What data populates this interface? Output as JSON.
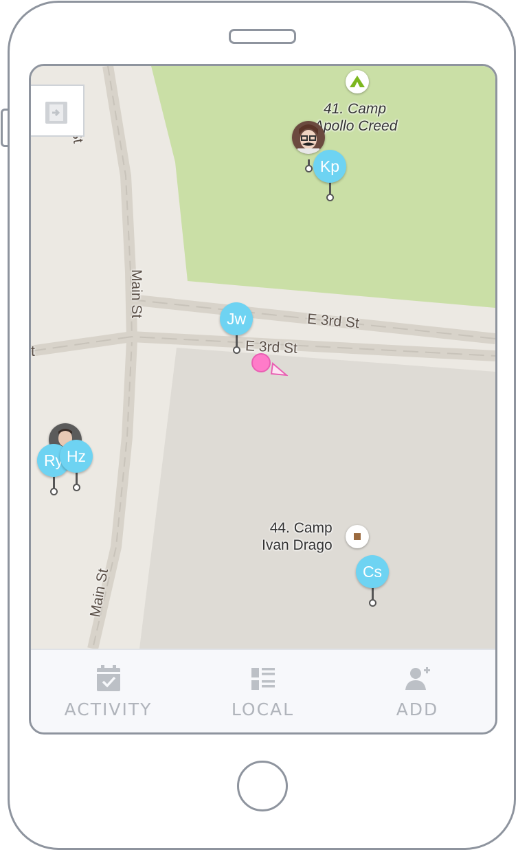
{
  "map": {
    "streets": {
      "main_st_top": "Main St",
      "main_st_mid": "Main St",
      "main_st_bottom": "Main St",
      "e3rd_upper": "E 3rd St",
      "e3rd_lower": "E 3rd St",
      "cut_off_left": "t"
    },
    "pois": {
      "camp41_line1": "41. Camp",
      "camp41_line2": "Apollo Creed",
      "camp44_line1": "44. Camp",
      "camp44_line2": "Ivan Drago"
    },
    "markers": {
      "kp": "Kp",
      "jw": "Jw",
      "ry": "Ry",
      "hz": "Hz",
      "cs": "Cs"
    },
    "colors": {
      "park": "#cadfa6",
      "block": "#dedbd5",
      "marker": "#6ed3f2",
      "user": "#ff7bc9",
      "camp_icon_green": "#7cb71f",
      "camp_icon_brown": "#9b6a3f"
    }
  },
  "tabbar": {
    "activity": "ACTIVITY",
    "local": "LOCAL",
    "add": "ADD"
  }
}
